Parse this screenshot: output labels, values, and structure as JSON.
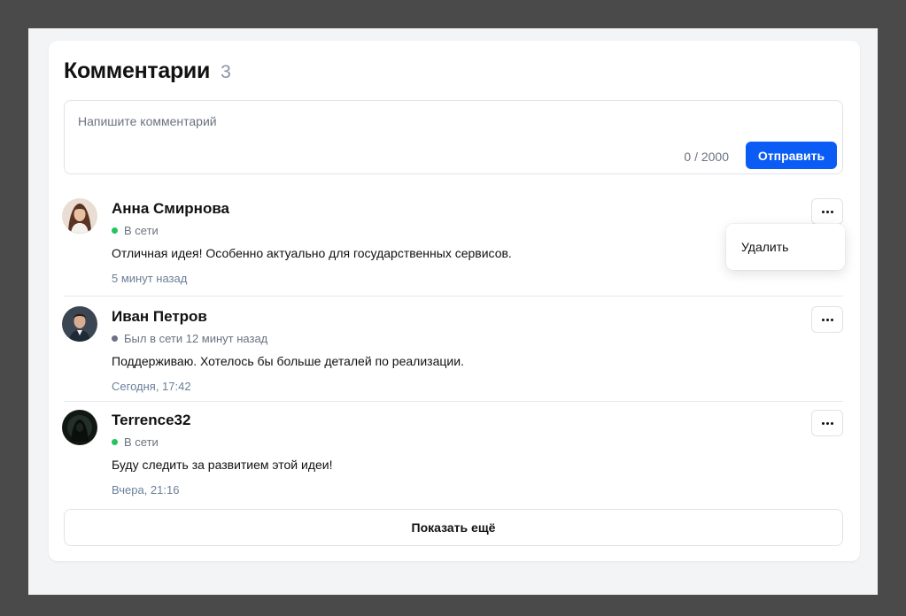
{
  "comments_section": {
    "title": "Комментарии",
    "count": "3"
  },
  "composer": {
    "placeholder": "Напишите комментарий",
    "char_counter": "0 / 2000",
    "send_label": "Отправить"
  },
  "colors": {
    "accent": "#0a5cf5",
    "online": "#22c55e",
    "offline": "#6b7280"
  },
  "comments": [
    {
      "author": "Анна Смирнова",
      "status": "В сети",
      "status_type": "online",
      "text": "Отличная идея! Особенно актуально для государственных сервисов.",
      "time": "5 минут назад"
    },
    {
      "author": "Иван Петров",
      "status": "Был в сети 12 минут назад",
      "status_type": "offline",
      "text": "Поддерживаю. Хотелось бы больше деталей по реализации.",
      "time": "Сегодня, 17:42"
    },
    {
      "author": "Terrence32",
      "status": "В сети",
      "status_type": "online",
      "text": "Буду следить за развитием этой идеи!",
      "time": "Вчера, 21:16"
    }
  ],
  "dropdown": {
    "delete_label": "Удалить"
  },
  "show_more_label": "Показать ещё"
}
